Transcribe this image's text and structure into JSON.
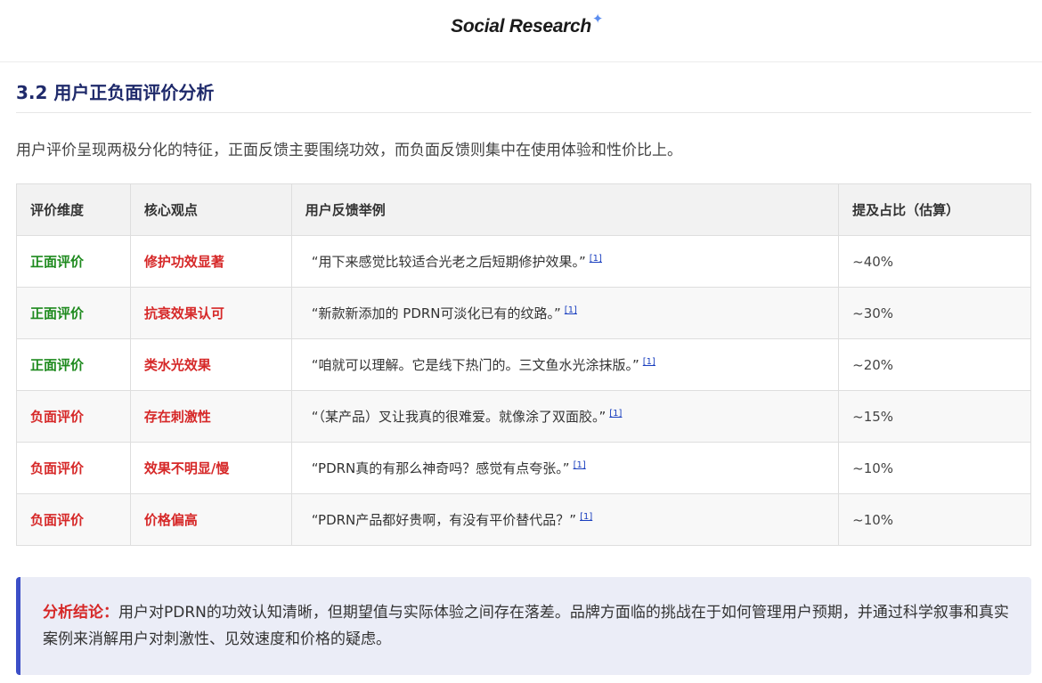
{
  "header": {
    "brand": "Social Research",
    "brand_icon": "sparkle-icon",
    "accent_color": "#5b8def"
  },
  "section": {
    "title": "3.2 用户正负面评价分析",
    "intro": "用户评价呈现两极分化的特征，正面反馈主要围绕功效，而负面反馈则集中在使用体验和性价比上。"
  },
  "table": {
    "headers": [
      "评价维度",
      "核心观点",
      "用户反馈举例",
      "提及占比（估算）"
    ],
    "rows": [
      {
        "dimension": "正面评价",
        "sentiment": "positive",
        "core": "修护功效显著",
        "quote": "“用下来感觉比较适合光老之后短期修护效果。”",
        "cite": "[1]",
        "share": "~40%"
      },
      {
        "dimension": "正面评价",
        "sentiment": "positive",
        "core": "抗衰效果认可",
        "quote": "“新款新添加的 PDRN可淡化已有的纹路。”",
        "cite": "[1]",
        "share": "~30%"
      },
      {
        "dimension": "正面评价",
        "sentiment": "positive",
        "core": "类水光效果",
        "quote": "“咱就可以理解。它是线下热门的。三文鱼水光涂抹版。”",
        "cite": "[1]",
        "share": "~20%"
      },
      {
        "dimension": "负面评价",
        "sentiment": "negative",
        "core": "存在刺激性",
        "quote": "“（某产品）叉让我真的很难爱。就像涂了双面胶。”",
        "cite": "[1]",
        "share": "~15%"
      },
      {
        "dimension": "负面评价",
        "sentiment": "negative",
        "core": "效果不明显/慢",
        "quote": "“PDRN真的有那么神奇吗？感觉有点夸张。”",
        "cite": "[1]",
        "share": "~10%"
      },
      {
        "dimension": "负面评价",
        "sentiment": "negative",
        "core": "价格偏高",
        "quote": "“PDRN产品都好贵啊，有没有平价替代品？”",
        "cite": "[1]",
        "share": "~10%"
      }
    ],
    "colors": {
      "positive": "#1e8a1e",
      "negative": "#d62828"
    }
  },
  "conclusion": {
    "label": "分析结论：",
    "text": "用户对PDRN的功效认知清晰，但期望值与实际体验之间存在落差。品牌方面临的挑战在于如何管理用户预期，并通过科学叙事和真实案例来消解用户对刺激性、见效速度和价格的疑虑。",
    "accent_color": "#3c4fc7"
  }
}
